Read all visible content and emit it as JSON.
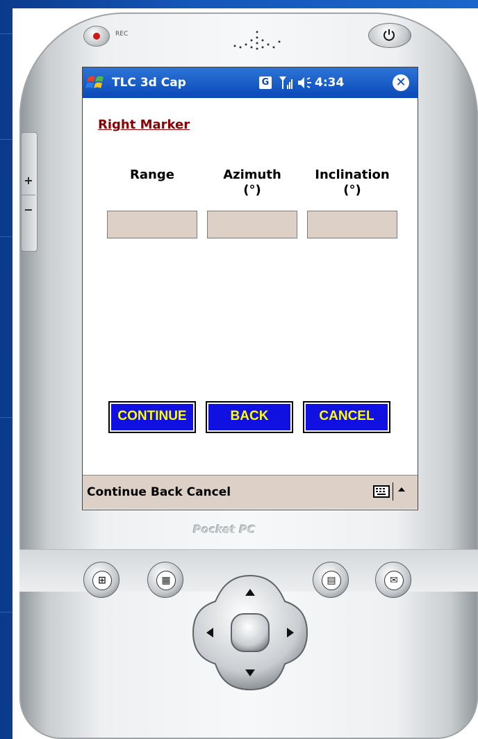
{
  "device": {
    "rec_label": "REC",
    "brand": "Pocket PC",
    "volume_up": "+",
    "volume_down": "−"
  },
  "titlebar": {
    "app_title": "TLC 3d Cap",
    "g_badge": "G",
    "time": "4:34"
  },
  "form": {
    "title": "Right Marker",
    "columns": [
      {
        "label": "Range",
        "unit": ""
      },
      {
        "label": "Azimuth",
        "unit": "(°)"
      },
      {
        "label": "Inclination",
        "unit": "(°)"
      }
    ],
    "fields": [
      {
        "value": ""
      },
      {
        "value": ""
      },
      {
        "value": ""
      }
    ],
    "buttons": {
      "continue": "CONTINUE",
      "back": "BACK",
      "cancel": "CANCEL"
    }
  },
  "command_bar": {
    "text": "Continue Back Cancel"
  },
  "colors": {
    "titlebar": "#0a49b8",
    "button_bg": "#1010e0",
    "button_text": "#ffff00",
    "field_bg": "#ddd1c7",
    "marker_title": "#8b0000"
  },
  "icons": [
    "start-flag-icon",
    "signal-icon",
    "volume-icon",
    "close-icon",
    "keyboard-icon",
    "up-arrow-icon",
    "windows-icon",
    "calendar-icon",
    "contacts-icon",
    "mail-icon",
    "power-icon",
    "record-icon"
  ]
}
